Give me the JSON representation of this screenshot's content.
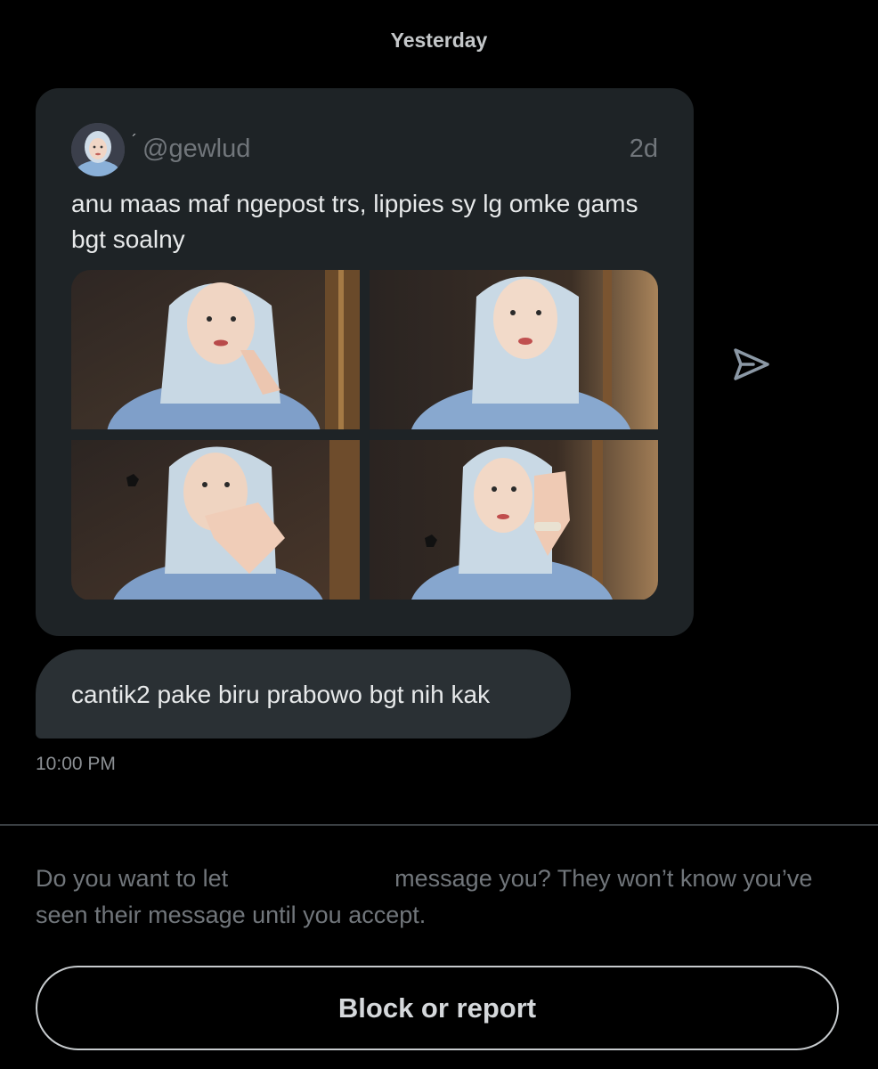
{
  "conversation": {
    "date_separator": "Yesterday"
  },
  "shared_post": {
    "handle": "@gewlud",
    "time_ago": "2d",
    "text": "anu maas maf ngepost trs, lippies sy lg omke gams bgt soalny",
    "photos": [
      "photo-1",
      "photo-2",
      "photo-3",
      "photo-4"
    ],
    "avatar_icon": "user-avatar",
    "share_icon": "send-icon"
  },
  "message": {
    "text": "cantik2 pake biru prabowo bgt nih kak",
    "time": "10:00 PM"
  },
  "request": {
    "prompt_before": "Do you want to let",
    "prompt_after": "message you? They won’t know you’ve seen their message until you accept.",
    "block_label": "Block or report"
  },
  "colors": {
    "background": "#000000",
    "card": "#1e2326",
    "bubble": "#2a3034",
    "muted_text": "#71767b",
    "primary_text": "#e7e9ea"
  }
}
